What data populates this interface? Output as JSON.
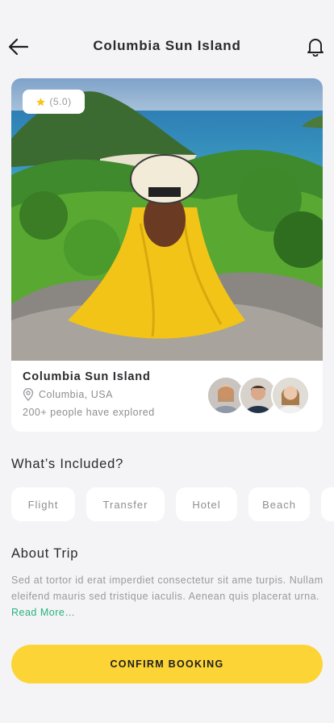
{
  "header": {
    "title": "Columbia Sun Island",
    "back_icon": "arrow-left-icon",
    "bell_icon": "bell-icon"
  },
  "card": {
    "rating": "(5.0)",
    "title": "Columbia Sun Island",
    "location": "Columbia, USA",
    "explored": "200+ people have explored"
  },
  "included": {
    "title": "What’s Included?",
    "items": [
      "Flight",
      "Transfer",
      "Hotel",
      "Beach"
    ]
  },
  "about": {
    "title": "About Trip",
    "text": "Sed at tortor id erat imperdiet consectetur sit ame turpis. Nullam eleifend mauris sed tristique iaculis. Aenean quis placerat urna. ",
    "read_more": "Read More…"
  },
  "confirm_label": "CONFIRM BOOKING",
  "colors": {
    "accent": "#fcd436",
    "link": "#26b37d",
    "background": "#f4f4f6"
  }
}
